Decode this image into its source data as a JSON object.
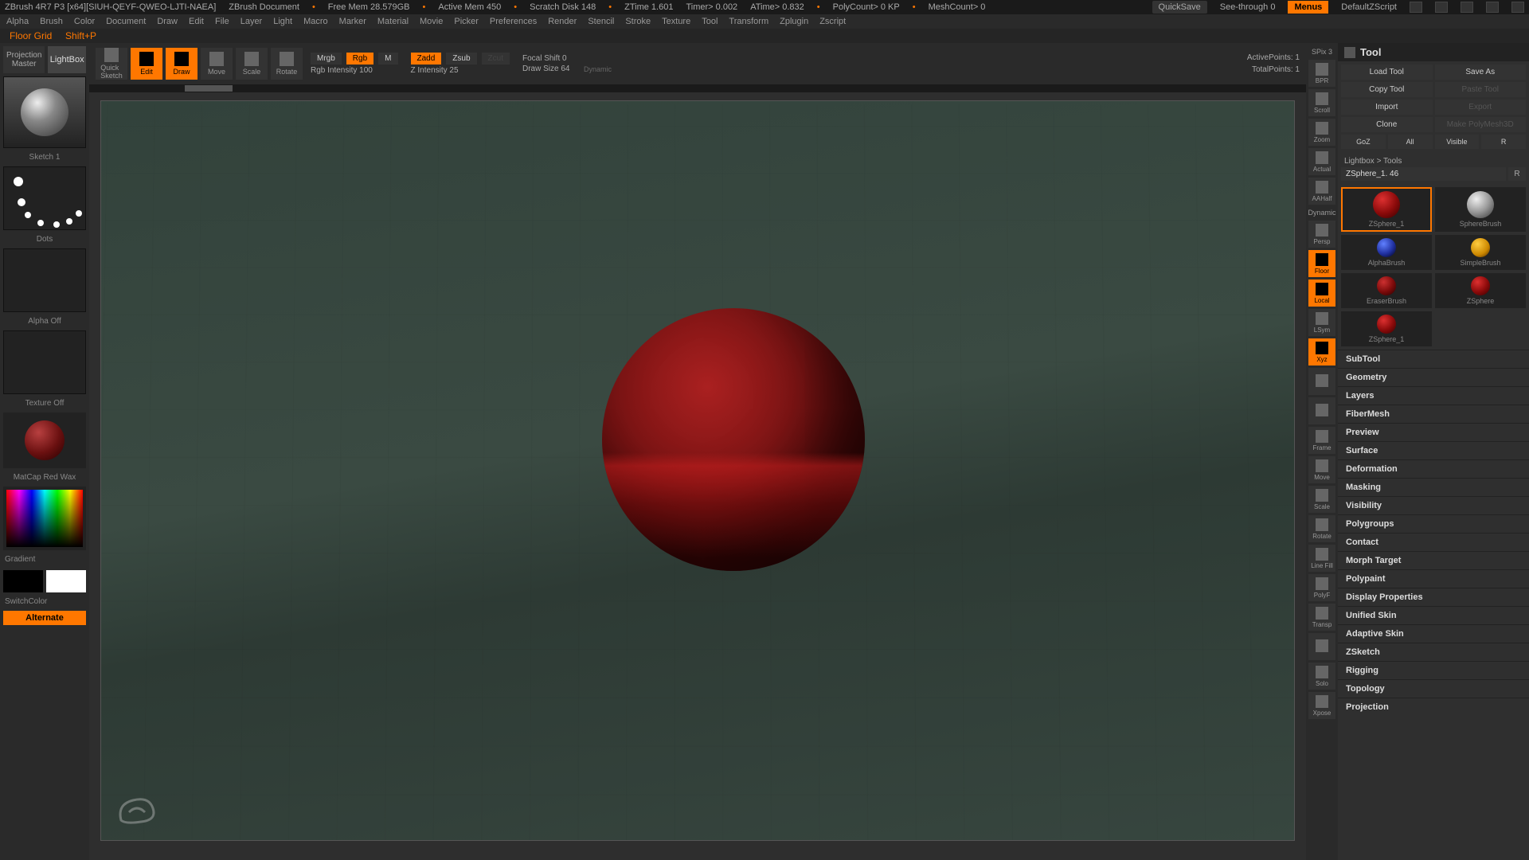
{
  "title_bar": {
    "app": "ZBrush 4R7 P3 [x64][SIUH-QEYF-QWEO-LJTI-NAEA]",
    "doc": "ZBrush Document",
    "freemem": "Free Mem 28.579GB",
    "activemem": "Active Mem 450",
    "scratch": "Scratch Disk 148",
    "ztime": "ZTime 1.601",
    "timer": "Timer> 0.002",
    "atime": "ATime> 0.832",
    "polycount": "PolyCount> 0 KP",
    "meshcount": "MeshCount> 0",
    "quicksave": "QuickSave",
    "seethrough": "See-through  0",
    "menus": "Menus",
    "script": "DefaultZScript"
  },
  "menus": [
    "Alpha",
    "Brush",
    "Color",
    "Document",
    "Draw",
    "Edit",
    "File",
    "Layer",
    "Light",
    "Macro",
    "Marker",
    "Material",
    "Movie",
    "Picker",
    "Preferences",
    "Render",
    "Stencil",
    "Stroke",
    "Texture",
    "Tool",
    "Transform",
    "Zplugin",
    "Zscript"
  ],
  "status": {
    "left": "Floor Grid",
    "right": "Shift+P"
  },
  "left": {
    "projection_master": "Projection\nMaster",
    "lightbox": "LightBox",
    "sketch_label": "Sketch 1",
    "stroke_label": "Dots",
    "alpha_label": "Alpha Off",
    "texture_label": "Texture Off",
    "material_label": "MatCap Red Wax",
    "gradient": "Gradient",
    "switchcolor": "SwitchColor",
    "alternate": "Alternate"
  },
  "toolbar": {
    "quicksketch": "Quick\nSketch",
    "edit": "Edit",
    "draw": "Draw",
    "move": "Move",
    "scale": "Scale",
    "rotate": "Rotate",
    "mrgb": "Mrgb",
    "rgb": "Rgb",
    "m": "M",
    "rgb_intensity": "Rgb Intensity 100",
    "zadd": "Zadd",
    "zsub": "Zsub",
    "zcut": "Zcut",
    "z_intensity": "Z Intensity 25",
    "focal_shift": "Focal Shift 0",
    "draw_size": "Draw Size 64",
    "dynamic": "Dynamic",
    "active_points": "ActivePoints: 1",
    "total_points": "TotalPoints: 1"
  },
  "right_buttons": {
    "spix": "SPix 3",
    "items": [
      "BPR",
      "Scroll",
      "Zoom",
      "Actual",
      "AAHalf",
      "Persp",
      "Floor",
      "Local",
      "LSym",
      "Xyz",
      "",
      "",
      "Frame",
      "Move",
      "Scale",
      "Rotate",
      "Line Fill",
      "PolyF",
      "Transp",
      "",
      "Solo",
      "Xpose"
    ],
    "active_idx": [
      6,
      7,
      9
    ],
    "dynamic": "Dynamic"
  },
  "right_panel": {
    "title": "Tool",
    "buttons": {
      "load": "Load Tool",
      "save": "Save As",
      "copy": "Copy Tool",
      "paste": "Paste Tool",
      "import": "Import",
      "export": "Export",
      "clone": "Clone",
      "makepoly": "Make PolyMesh3D",
      "goz": "GoZ",
      "all": "All",
      "visible": "Visible",
      "r": "R",
      "lightbox_tools": "Lightbox > Tools",
      "name": "ZSphere_1. 46",
      "r2": "R"
    },
    "thumbs": [
      {
        "label": "ZSphere_1",
        "color": "radial-gradient(circle at 35% 30%,#dd3030,#8a0a0a 55%,#300)",
        "sel": true
      },
      {
        "label": "SphereBrush",
        "color": "radial-gradient(circle at 35% 30%,#eee,#999 50%,#333)"
      },
      {
        "label": "AlphaBrush",
        "color": "radial-gradient(circle at 35% 30%,#6080ff,#2030a0 55%,#001)"
      },
      {
        "label": "SimpleBrush",
        "color": "radial-gradient(circle at 35% 30%,#ffcc40,#cc8800 60%,#442200)"
      },
      {
        "label": "EraserBrush",
        "color": "radial-gradient(circle at 35% 30%,#cc3030,#7a0a0a 55%,#200)"
      },
      {
        "label": "ZSphere",
        "color": "radial-gradient(circle at 35% 30%,#dd3030,#8a0a0a 55%,#300)"
      },
      {
        "label": "ZSphere_1",
        "color": "radial-gradient(circle at 35% 30%,#dd3030,#8a0a0a 55%,#300)"
      }
    ],
    "sections": [
      "SubTool",
      "Geometry",
      "Layers",
      "FiberMesh",
      "Preview",
      "Surface",
      "Deformation",
      "Masking",
      "Visibility",
      "Polygroups",
      "Contact",
      "Morph Target",
      "Polypaint",
      "Display Properties",
      "Unified Skin",
      "Adaptive Skin",
      "ZSketch",
      "Rigging",
      "Topology",
      "Projection"
    ]
  },
  "chart_data": null
}
